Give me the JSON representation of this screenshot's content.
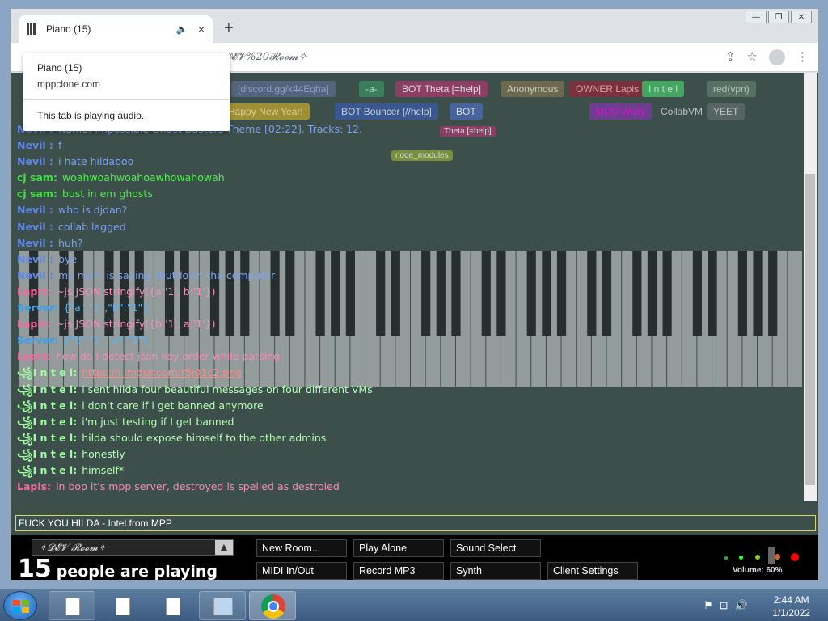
{
  "browser": {
    "tab_title": "Piano (15)",
    "new_tab": "+",
    "tab_close": "×",
    "tab_speaker": "🔈",
    "url": "✧𝓓𝓔𝓥%20𝓡𝓸𝓸𝓶✧",
    "window_controls": [
      "—",
      "❐",
      "✕"
    ],
    "toolbar_icons": [
      "share-icon",
      "star-icon",
      "account-icon",
      "menu-icon"
    ],
    "share": "⇪",
    "star": "☆",
    "menu": "⋮"
  },
  "popup": {
    "title": "Piano (15)",
    "site": "mppclone.com",
    "status": "This tab is playing audio."
  },
  "participants": [
    {
      "label": "[discord.gg/k44Eqha]",
      "color": "#5a6a8a",
      "fg": "#9fb3e8"
    },
    {
      "label": "-a-",
      "color": "#3c8a5f",
      "fg": "#cfe"
    },
    {
      "label": "BOT Theta [=help]",
      "color": "#a03a6c",
      "fg": "#fff"
    },
    {
      "label": "Anonymous",
      "color": "#7a7050",
      "fg": "#eed"
    },
    {
      "label": "OWNER Lapis",
      "color": "#8a2a3a",
      "fg": "#fbb"
    },
    {
      "label": "I n t e l",
      "color": "#48bb68",
      "fg": "#eaffea"
    },
    {
      "label": "red(vpn)",
      "color": "#5d7a6a",
      "fg": "#ddd"
    },
    {
      "label": "Happy New Year!",
      "color": "#b8a030",
      "fg": "#fff6aa"
    },
    {
      "label": "BOT Bouncer [//help]",
      "color": "#3a5aa0",
      "fg": "#e8f0ff"
    },
    {
      "label": "BOT",
      "color": "#4a6ab0",
      "fg": "#fff"
    },
    {
      "label": "MOD Wolfy",
      "color": "#7a3aa0",
      "fg": "#f0e"
    },
    {
      "label": "CollabVM",
      "color": "#3d4f4b",
      "fg": "#ddd"
    },
    {
      "label": "YEET",
      "color": "#5d6a6a",
      "fg": "#ddd"
    }
  ],
  "cursor_labels": [
    "Theta [=help]",
    "node_modules"
  ],
  "chat": [
    {
      "name": "Nevil :",
      "text": "Name: Impossible Ghost Busters Theme [02:22]. Tracks: 12.",
      "ncolor": "#5f87e8",
      "tcolor": "#7da0f0"
    },
    {
      "name": "Nevil :",
      "text": "f",
      "ncolor": "#5f87e8",
      "tcolor": "#7da0f0"
    },
    {
      "name": "Nevil :",
      "text": "i hate hildaboo",
      "ncolor": "#5f87e8",
      "tcolor": "#7da0f0"
    },
    {
      "name": "cj sam:",
      "text": "woahwoahwoahoawhowahowah",
      "ncolor": "#3fdf3f",
      "tcolor": "#4ff04f"
    },
    {
      "name": "cj sam:",
      "text": "bust in em ghosts",
      "ncolor": "#3fdf3f",
      "tcolor": "#4ff04f"
    },
    {
      "name": "Nevil :",
      "text": "who is djdan?",
      "ncolor": "#5f87e8",
      "tcolor": "#7da0f0"
    },
    {
      "name": "Nevil :",
      "text": "collab lagged",
      "ncolor": "#5f87e8",
      "tcolor": "#7da0f0"
    },
    {
      "name": "Nevil :",
      "text": "huh?",
      "ncolor": "#5f87e8",
      "tcolor": "#7da0f0"
    },
    {
      "name": "Nevil :",
      "text": "bye",
      "ncolor": "#5f87e8",
      "tcolor": "#7da0f0"
    },
    {
      "name": "Nevil :",
      "text": "my mom is saying shutdown the computer",
      "ncolor": "#5f87e8",
      "tcolor": "#7da0f0"
    },
    {
      "name": "Lapis:",
      "text": "~js JSON.stringify({a:'1', b:'1'})",
      "ncolor": "#f06aa0",
      "tcolor": "#f48cb8"
    },
    {
      "name": "Server:",
      "text": "{\"a\":\"1\",\"b\":\"1\"}",
      "ncolor": "#3a9ff0",
      "tcolor": "#5ab4f6"
    },
    {
      "name": "Lapis:",
      "text": "~js JSON.stringify({b:'1', a:'1'})",
      "ncolor": "#f06aa0",
      "tcolor": "#f48cb8"
    },
    {
      "name": "Server:",
      "text": "{\"b\":\"1\",\"a\":\"1\"}",
      "ncolor": "#3a9ff0",
      "tcolor": "#5ab4f6"
    },
    {
      "name": "Lapis:",
      "text": "how do I detect json key order while parsing",
      "ncolor": "#f06aa0",
      "tcolor": "#f48cb8"
    },
    {
      "name": "꧁I n t e l:",
      "text": "https://i.imgur.com/r5j01c2.png",
      "ncolor": "#9fff9f",
      "tcolor": "#ff8888",
      "link": true
    },
    {
      "name": "꧁I n t e l:",
      "text": "i sent hilda four beautiful messages on four different VMs",
      "ncolor": "#9fff9f",
      "tcolor": "#b6ffb6"
    },
    {
      "name": "꧁I n t e l:",
      "text": "i don't care if i get banned anymore",
      "ncolor": "#9fff9f",
      "tcolor": "#b6ffb6"
    },
    {
      "name": "꧁I n t e l:",
      "text": "i'm just testing if I get banned",
      "ncolor": "#9fff9f",
      "tcolor": "#b6ffb6"
    },
    {
      "name": "꧁I n t e l:",
      "text": "hilda should expose himself to the other admins",
      "ncolor": "#9fff9f",
      "tcolor": "#b6ffb6"
    },
    {
      "name": "꧁I n t e l:",
      "text": "honestly",
      "ncolor": "#9fff9f",
      "tcolor": "#b6ffb6"
    },
    {
      "name": "꧁I n t e l:",
      "text": "himself*",
      "ncolor": "#9fff9f",
      "tcolor": "#b6ffb6"
    },
    {
      "name": "Lapis:",
      "text": "in bop it's mpp server, destroyed is spelled as destroied",
      "ncolor": "#f06aa0",
      "tcolor": "#f48cb8"
    }
  ],
  "chat_input": {
    "value": "FUCK YOU HILDA - Intel from MPP"
  },
  "bottom": {
    "room_name": "✧𝓓𝓔𝓥 𝓡𝓸𝓸𝓶✧",
    "room_arrow": "▲",
    "count": "15",
    "count_text": "people are playing",
    "buttons": [
      "New Room...",
      "Play Alone",
      "Sound Select",
      "MIDI In/Out",
      "Record MP3",
      "Synth",
      "Client Settings"
    ],
    "volume_label": "Volume: 60%",
    "volume": 0.6
  },
  "taskbar": {
    "time": "2:44 AM",
    "date": "1/1/2022",
    "tray_icons": [
      "flag-icon",
      "network-icon",
      "speaker-icon"
    ],
    "tray_glyphs": [
      "⚑",
      "⊡",
      "🔊"
    ]
  }
}
